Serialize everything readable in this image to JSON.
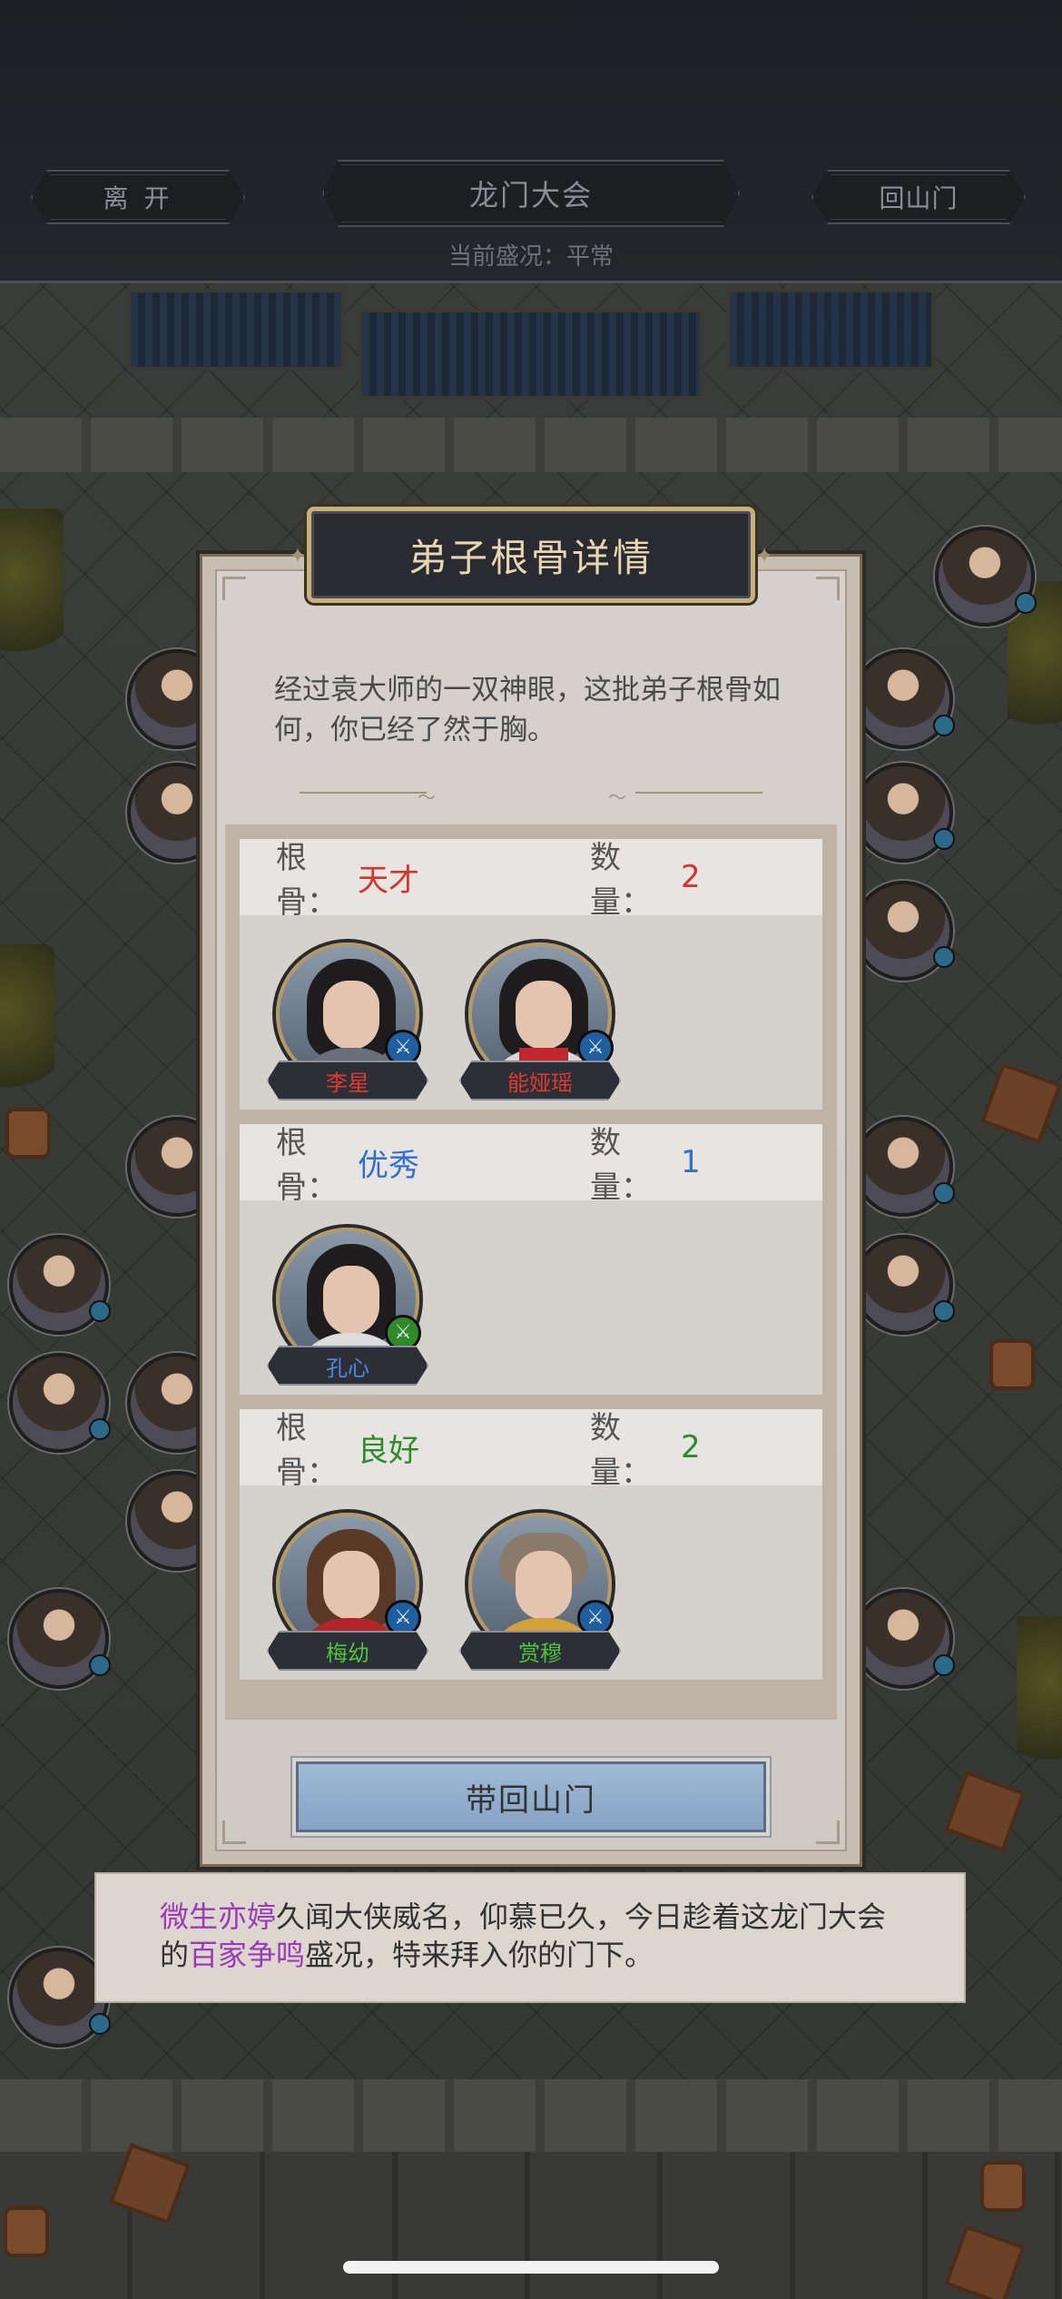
{
  "header": {
    "leave_label": "离 开",
    "event_title": "龙门大会",
    "home_label": "回山门",
    "status_text": "当前盛况：平常"
  },
  "modal": {
    "title": "弟子根骨详情",
    "intro": "经过袁大师的一双神眼，这批弟子根骨如何，你已经了然于胸。",
    "groups": [
      {
        "grade_label": "根骨：",
        "grade": "天才",
        "count_label": "数量：",
        "count": "2",
        "color": "#d3362a",
        "disciples": [
          {
            "name": "李星",
            "style": "male",
            "weapon_icon": "sword-icon"
          },
          {
            "name": "能娅瑶",
            "style": "female",
            "weapon_icon": "sword-icon"
          }
        ]
      },
      {
        "grade_label": "根骨：",
        "grade": "优秀",
        "count_label": "数量：",
        "count": "1",
        "color": "#2f6fd0",
        "disciples": [
          {
            "name": "孔心",
            "style": "male",
            "weapon_icon": "blade-icon"
          }
        ]
      },
      {
        "grade_label": "根骨：",
        "grade": "良好",
        "count_label": "数量：",
        "count": "2",
        "color": "#2e8a2a",
        "disciples": [
          {
            "name": "梅幼",
            "style": "gold",
            "weapon_icon": "sword-icon"
          },
          {
            "name": "赏穆",
            "style": "monk",
            "weapon_icon": "sword-icon"
          }
        ]
      }
    ],
    "bring_back_label": "带回山门"
  },
  "message": {
    "name": "微生亦婷",
    "part1": "久闻大侠威名，仰慕已久，今日趁着这龙门大会的",
    "highlight": "百家争鸣",
    "part2": "盛况，特来拜入你的门下。",
    "highlight_color": "#9a3ab8"
  }
}
